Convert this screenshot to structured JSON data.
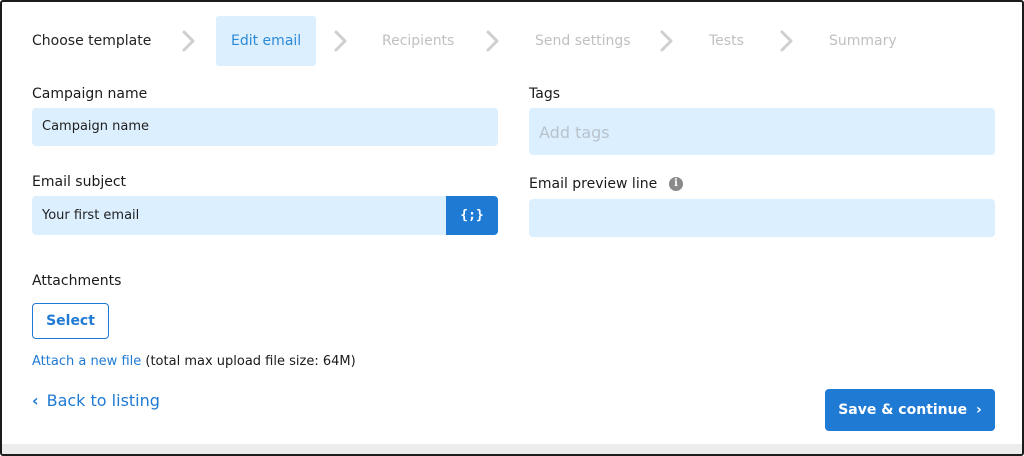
{
  "stepper": {
    "steps": [
      {
        "label": "Choose template",
        "state": "done"
      },
      {
        "label": "Edit email",
        "state": "active"
      },
      {
        "label": "Recipients",
        "state": "todo"
      },
      {
        "label": "Send settings",
        "state": "todo"
      },
      {
        "label": "Tests",
        "state": "todo"
      },
      {
        "label": "Summary",
        "state": "todo"
      }
    ],
    "separator_icon": "chevron-right-icon"
  },
  "form": {
    "campaign_name": {
      "label": "Campaign name",
      "value": "Campaign name"
    },
    "tags": {
      "label": "Tags",
      "placeholder": "Add tags"
    },
    "email_subject": {
      "label": "Email subject",
      "value": "Your first email",
      "variable_button": "{;}"
    },
    "email_preview": {
      "label": "Email preview line",
      "value": "",
      "info_icon": "info-icon"
    },
    "attachments": {
      "label": "Attachments",
      "select_button": "Select",
      "attach_link": "Attach a new file",
      "attach_note": "(total max upload file size: 64M)"
    }
  },
  "footer": {
    "back_label": "Back to listing",
    "save_label": "Save & continue"
  },
  "colors": {
    "accent": "#1f7ad4",
    "field_bg": "#dcefff",
    "active_step_text": "#2d8ad6",
    "todo_step_text": "#c0c0c0"
  }
}
